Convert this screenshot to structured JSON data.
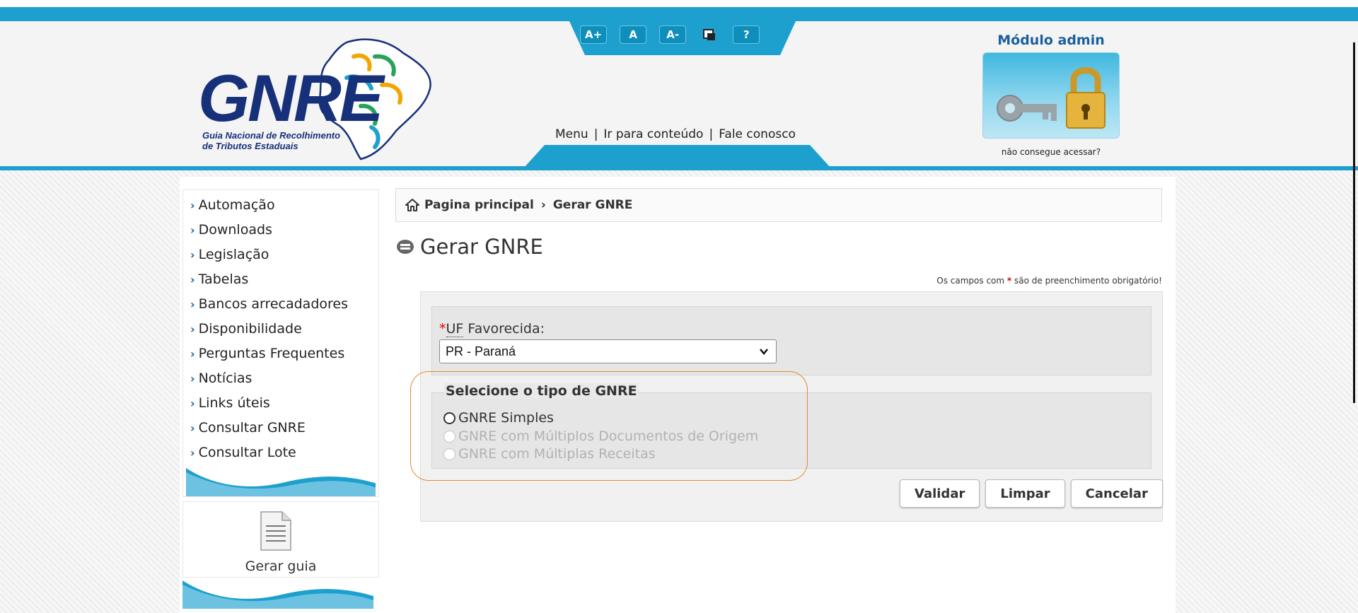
{
  "header": {
    "logo_text": "GNRE",
    "logo_sub_line1": "Guia Nacional de Recolhimento",
    "logo_sub_line2": "de Tributos Estaduais",
    "accessibility": [
      "A+",
      "A",
      "A-",
      "?"
    ],
    "top_links": [
      "Menu",
      "Ir para conteúdo",
      "Fale conosco"
    ],
    "admin_title": "Módulo admin",
    "admin_note": "não consegue acessar?"
  },
  "sidebar": {
    "items": [
      "Automação",
      "Downloads",
      "Legislação",
      "Tabelas",
      "Bancos arrecadadores",
      "Disponibilidade",
      "Perguntas Frequentes",
      "Notícias",
      "Links úteis",
      "Consultar GNRE",
      "Consultar Lote"
    ],
    "guide_label": "Gerar guia"
  },
  "breadcrumb": {
    "home": "Pagina principal",
    "current": "Gerar GNRE"
  },
  "page_title": "Gerar GNRE",
  "required_note": {
    "before": "Os campos com",
    "star": "*",
    "after": "são de preenchimento obrigatório!"
  },
  "form": {
    "uf_star": "*",
    "uf_abbr": "UF",
    "uf_label_rest": " Favorecida:",
    "uf_selected": "PR - Paraná",
    "type_legend": "Selecione o tipo de GNRE",
    "types": [
      {
        "label": "GNRE Simples",
        "enabled": true
      },
      {
        "label": "GNRE com Múltiplos Documentos de Origem",
        "enabled": false
      },
      {
        "label": "GNRE com Múltiplas Receitas",
        "enabled": false
      }
    ],
    "buttons": {
      "validate": "Validar",
      "clear": "Limpar",
      "cancel": "Cancelar"
    }
  },
  "colors": {
    "accent": "#1ea0cf",
    "brand_blue": "#16307a",
    "highlight": "#e28b2a",
    "required_star": "#dd0000"
  }
}
